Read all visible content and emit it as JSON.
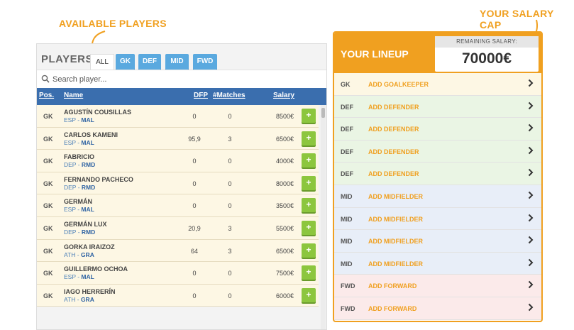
{
  "annotations": {
    "available_players": "AVAILABLE PLAYERS",
    "salary_cap": "YOUR SALARY CAP"
  },
  "players": {
    "title": "PLAYERS",
    "tabs": [
      "ALL",
      "GK",
      "DEF",
      "MID",
      "FWD"
    ],
    "active_tab": "ALL",
    "search_placeholder": "Search player...",
    "columns": {
      "pos": "Pos.",
      "name": "Name",
      "dfp": "DFP",
      "matches": "#Matches",
      "salary": "Salary"
    },
    "add_label": "+",
    "rows": [
      {
        "pos": "GK",
        "name": "AGUSTÍN COUSILLAS",
        "country": "ESP",
        "club": "MAL",
        "dfp": "0",
        "matches": "0",
        "salary": "8500€"
      },
      {
        "pos": "GK",
        "name": "CARLOS KAMENI",
        "country": "ESP",
        "club": "MAL",
        "dfp": "95,9",
        "matches": "3",
        "salary": "6500€"
      },
      {
        "pos": "GK",
        "name": "FABRICIO",
        "country": "DEP",
        "club": "RMD",
        "dfp": "0",
        "matches": "0",
        "salary": "4000€"
      },
      {
        "pos": "GK",
        "name": "FERNANDO PACHECO",
        "country": "DEP",
        "club": "RMD",
        "dfp": "0",
        "matches": "0",
        "salary": "8000€"
      },
      {
        "pos": "GK",
        "name": "GERMÁN",
        "country": "ESP",
        "club": "MAL",
        "dfp": "0",
        "matches": "0",
        "salary": "3500€"
      },
      {
        "pos": "GK",
        "name": "GERMÁN LUX",
        "country": "DEP",
        "club": "RMD",
        "dfp": "20,9",
        "matches": "3",
        "salary": "5500€"
      },
      {
        "pos": "GK",
        "name": "GORKA IRAIZOZ",
        "country": "ATH",
        "club": "GRA",
        "dfp": "64",
        "matches": "3",
        "salary": "6500€"
      },
      {
        "pos": "GK",
        "name": "GUILLERMO OCHOA",
        "country": "ESP",
        "club": "MAL",
        "dfp": "0",
        "matches": "0",
        "salary": "7500€"
      },
      {
        "pos": "GK",
        "name": "IAGO HERRERÍN",
        "country": "ATH",
        "club": "GRA",
        "dfp": "0",
        "matches": "0",
        "salary": "6000€"
      }
    ]
  },
  "lineup": {
    "title": "YOUR LINEUP",
    "remaining_label": "REMAINING SALARY:",
    "remaining_value": "70000€",
    "rows": [
      {
        "pos": "GK",
        "action": "ADD GOALKEEPER",
        "group": "gk"
      },
      {
        "pos": "DEF",
        "action": "ADD DEFENDER",
        "group": "def"
      },
      {
        "pos": "DEF",
        "action": "ADD DEFENDER",
        "group": "def"
      },
      {
        "pos": "DEF",
        "action": "ADD DEFENDER",
        "group": "def"
      },
      {
        "pos": "DEF",
        "action": "ADD DEFENDER",
        "group": "def"
      },
      {
        "pos": "MID",
        "action": "ADD MIDFIELDER",
        "group": "mid"
      },
      {
        "pos": "MID",
        "action": "ADD MIDFIELDER",
        "group": "mid"
      },
      {
        "pos": "MID",
        "action": "ADD MIDFIELDER",
        "group": "mid"
      },
      {
        "pos": "MID",
        "action": "ADD MIDFIELDER",
        "group": "mid"
      },
      {
        "pos": "FWD",
        "action": "ADD FORWARD",
        "group": "fwd"
      },
      {
        "pos": "FWD",
        "action": "ADD FORWARD",
        "group": "fwd"
      }
    ]
  },
  "colors": {
    "accent": "#f0a020",
    "header_blue": "#3a6eae",
    "tab_blue": "#5aa9df",
    "add_green": "#8cc63e"
  }
}
